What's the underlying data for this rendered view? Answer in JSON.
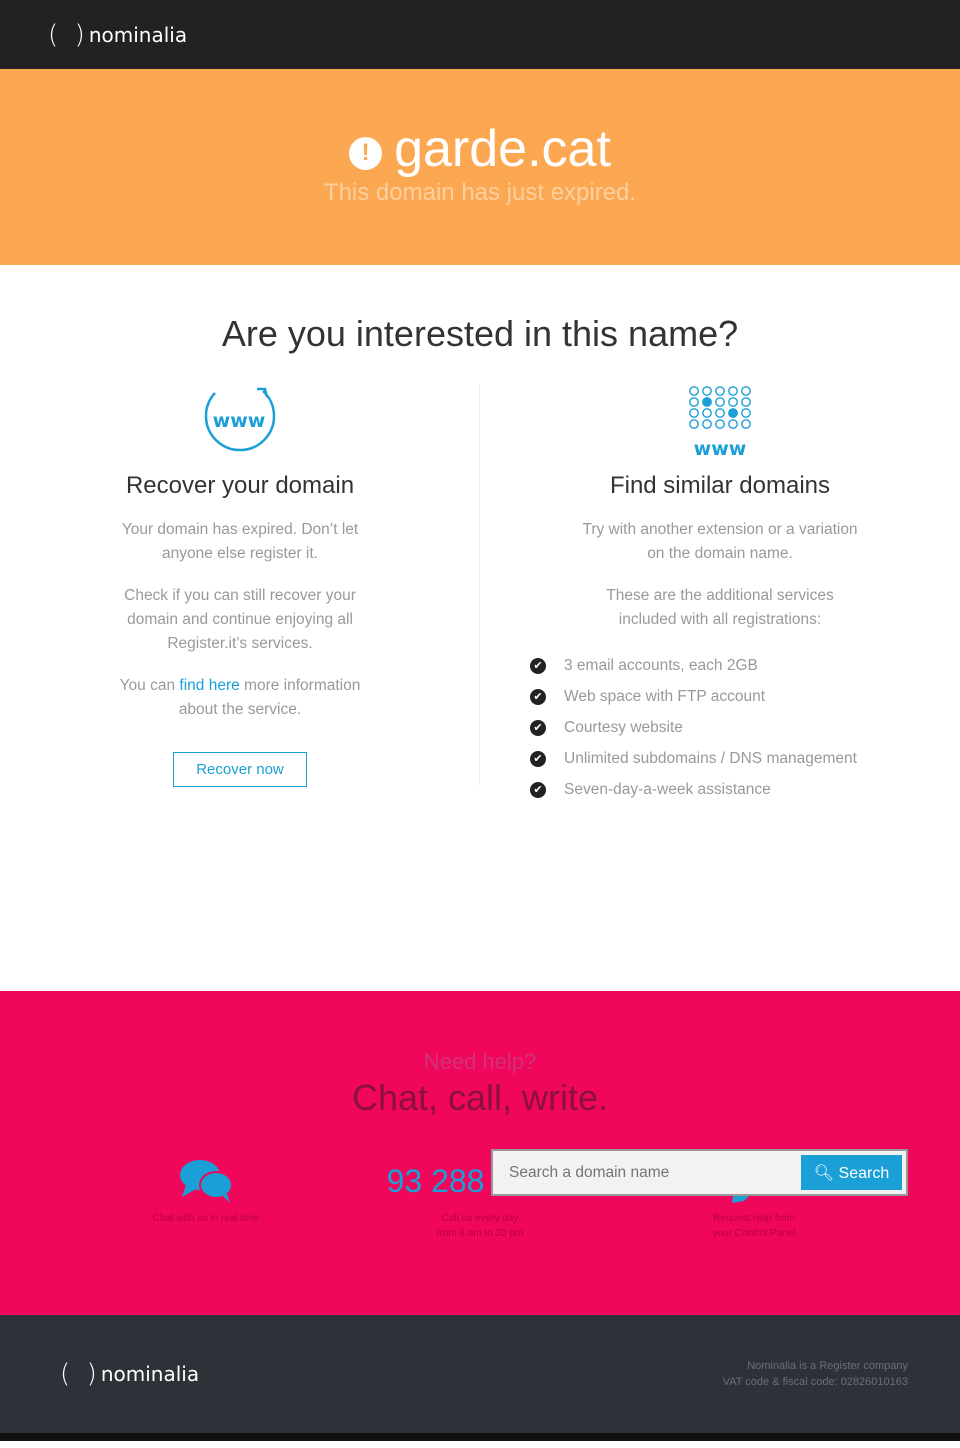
{
  "brand": {
    "name": "nominalia"
  },
  "hero": {
    "domain": "garde.cat",
    "subtitle": "This domain has just expired."
  },
  "main": {
    "title": "Are you interested in this name?",
    "recover": {
      "title": "Recover your domain",
      "p1": "Your domain has expired. Don’t let anyone else register it.",
      "p2": "Check if you can still recover your domain and continue enjoying all Register.it’s services.",
      "p3_pre": "You can ",
      "p3_link": "find here",
      "p3_post": " more information about the service.",
      "button": "Recover now",
      "icon_text": "www"
    },
    "similar": {
      "title": "Find similar domains",
      "p1": "Try with another extension or a variation on the domain name.",
      "p2": "These are the additional services included with all registrations:",
      "icon_text": "www",
      "features": [
        "3 email accounts, each 2GB",
        "Web space with FTP account",
        "Courtesy website",
        "Unlimited subdomains / DNS management",
        "Seven-day-a-week assistance"
      ]
    },
    "search": {
      "placeholder": "Search a domain name",
      "button": "Search"
    }
  },
  "help": {
    "need": "Need help?",
    "title": "Chat, call, write.",
    "chat": "Chat with us in real time",
    "phone": "93 288 40 62",
    "call1": "Call us every day",
    "call2": "from 8 am to 20 pm",
    "write1": "Request help from",
    "write2": "your Control Panel"
  },
  "footer": {
    "line1": "Nominalia is a Register company",
    "line2": "VAT code & fiscal code: 02826010163"
  },
  "colors": {
    "accent": "#1a9fd6",
    "hero": "#fca852",
    "help": "#f0065a",
    "footer": "#2e3138"
  }
}
